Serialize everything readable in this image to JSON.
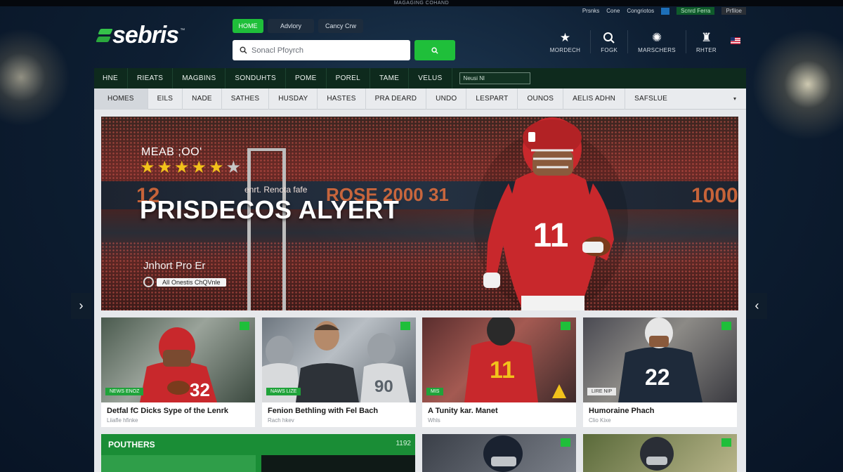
{
  "topstrip": "MAGAGING COHAND",
  "logo": {
    "text": "sebris",
    "tm": "™"
  },
  "toptabs": [
    {
      "label": "HOME",
      "active": true
    },
    {
      "label": "Advlory",
      "active": false
    },
    {
      "label": "Cancy Crw",
      "active": false
    }
  ],
  "search": {
    "placeholder": "Sonacl Pfoyrch"
  },
  "util_links": {
    "a": "Prsnks",
    "b": "Cone",
    "c": "Congriotos",
    "green": "Scnrd Ferra",
    "dark": "Prfiloe"
  },
  "header_icons": [
    {
      "icon": "star-icon",
      "glyph": "★",
      "label": "MORDECH"
    },
    {
      "icon": "search-icon",
      "glyph": "⚲",
      "label": "FOGK"
    },
    {
      "icon": "team-icon",
      "glyph": "✺",
      "label": "MARSCHERS"
    },
    {
      "icon": "trophy-icon",
      "glyph": "♜",
      "label": "RHTER"
    }
  ],
  "nav1": [
    "HNE",
    "RIEATS",
    "MAGBINS",
    "SONDUHTS",
    "POME",
    "POREL",
    "TAME",
    "VELUS"
  ],
  "nav1_input": "Neusi Nl",
  "nav2": [
    "HOMES",
    "EILS",
    "NADE",
    "SATHES",
    "HUSDAY",
    "HASTES",
    "PRA DEARD",
    "UNDO",
    "LESPART",
    "OUNOS",
    "AELIS ADHN",
    "SAFSLUE"
  ],
  "nav2_more": "▾",
  "hero": {
    "kicker": "MEAB ;OO'",
    "stars": 5,
    "sub": "enrt. Renota fafe",
    "title": "PRISDECOS ALYERT",
    "meta": "Jnhort Pro Er",
    "badge": "AlI Onestis ChQVnle",
    "board_left": "12",
    "board_mid": "ROSE 2000 31",
    "board_right": "1000",
    "jersey": "11"
  },
  "cards": [
    {
      "title": "Detfal fC Dicks Sype of the Lenrk",
      "sub": "Liiafle hfinke",
      "tag": "NEWS ENOZ",
      "jersey": "32",
      "color": "#c8282c",
      "chip": "g"
    },
    {
      "title": "Fenion Bethling with Fel Bach",
      "sub": "Rach hkev",
      "tag": "NAWS LIZE",
      "jersey": "90",
      "color": "#2d3238",
      "chip": "g"
    },
    {
      "title": "A Tunity kar. Manet",
      "sub": "Whls",
      "tag": "MIS",
      "jersey": "11",
      "color": "#c8282c",
      "chip": "g"
    },
    {
      "title": "Humoraine Phach",
      "sub": "Clio Kixe",
      "tag": "LIRE NIP",
      "jersey": "22",
      "color": "#1e2a3a",
      "chip": "g"
    }
  ],
  "bottom": {
    "label": "POUTHERS",
    "num": "1192"
  }
}
